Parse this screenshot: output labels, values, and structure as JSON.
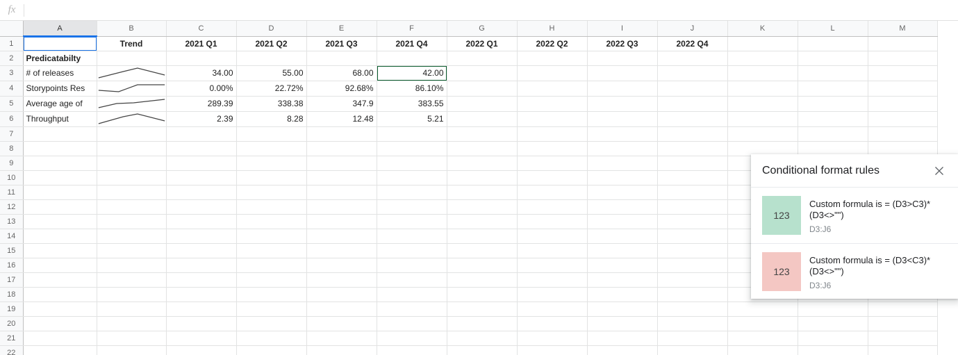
{
  "formula_bar": {
    "fx_label": "fx",
    "value": "",
    "placeholder": ""
  },
  "grid": {
    "column_headers": [
      "A",
      "B",
      "C",
      "D",
      "E",
      "F",
      "G",
      "H",
      "I",
      "J",
      "K",
      "L",
      "M"
    ],
    "row_headers": [
      "1",
      "2",
      "3",
      "4",
      "5",
      "6",
      "7",
      "8",
      "9",
      "10",
      "11",
      "12",
      "13",
      "14",
      "15",
      "16",
      "17",
      "18",
      "19",
      "20",
      "21",
      "22"
    ],
    "selected_column": "A",
    "selected_cell": "A1",
    "active_cell": "F3",
    "header_row": {
      "A": "",
      "B": "Trend",
      "C": "2021 Q1",
      "D": "2021 Q2",
      "E": "2021 Q3",
      "F": "2021 Q4",
      "G": "2022 Q1",
      "H": "2022 Q2",
      "I": "2022 Q3",
      "J": "2022 Q4"
    },
    "section_row": {
      "A": "Predicatabilty"
    },
    "rows": [
      {
        "label": "# of releases",
        "sparkline": "up-peak-down",
        "C": "34.00",
        "D": "55.00",
        "E": "68.00",
        "F": "42.00",
        "C_fmt": "none",
        "D_fmt": "green",
        "E_fmt": "green",
        "F_fmt": "red"
      },
      {
        "label": "Storypoints Res",
        "sparkline": "rise-flat",
        "C": "0.00%",
        "D": "22.72%",
        "E": "92.68%",
        "F": "86.10%",
        "C_fmt": "none",
        "D_fmt": "green",
        "E_fmt": "green",
        "F_fmt": "red"
      },
      {
        "label": "Average age of ",
        "sparkline": "gentle-rise",
        "C": "289.39",
        "D": "338.38",
        "E": "347.9",
        "F": "383.55",
        "C_fmt": "none",
        "D_fmt": "green",
        "E_fmt": "green",
        "F_fmt": "green"
      },
      {
        "label": "Throughput",
        "sparkline": "up-peak-down",
        "C": "2.39",
        "D": "8.28",
        "E": "12.48",
        "F": "5.21",
        "C_fmt": "none",
        "D_fmt": "green",
        "E_fmt": "green",
        "F_fmt": "red"
      }
    ]
  },
  "colors": {
    "header_green": "#93c47d",
    "section_yellow": "#ffe599",
    "cf_green": "#b7e1cd",
    "cf_red": "#f4c7c3",
    "active_border": "#0b5c2e",
    "selection_border": "#1a73e8"
  },
  "cf_panel": {
    "title": "Conditional format rules",
    "close_icon": "close-icon",
    "rules": [
      {
        "swatch_text": "123",
        "swatch_color": "#b7e1cd",
        "formula": "Custom formula is = (D3>C3)*(D3<>\"\")",
        "range": "D3:J6"
      },
      {
        "swatch_text": "123",
        "swatch_color": "#f4c7c3",
        "formula": "Custom formula is = (D3<C3)*(D3<>\"\")",
        "range": "D3:J6"
      }
    ]
  }
}
